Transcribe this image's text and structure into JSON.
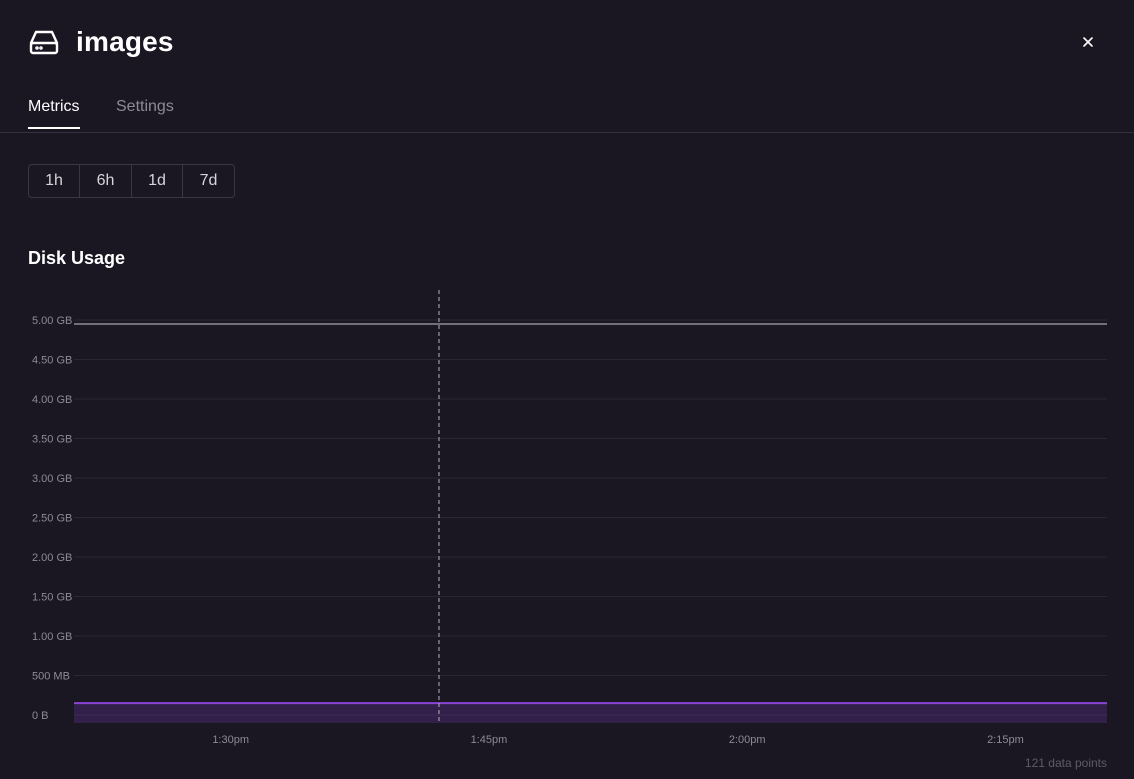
{
  "header": {
    "title": "images",
    "icon": "hard-drive-icon",
    "close_icon": "close-icon"
  },
  "tabs": [
    {
      "label": "Metrics",
      "active": true
    },
    {
      "label": "Settings",
      "active": false
    }
  ],
  "time_range": {
    "options": [
      "1h",
      "6h",
      "1d",
      "7d"
    ],
    "selected": "1h"
  },
  "section": {
    "title": "Disk Usage"
  },
  "chart_data": {
    "type": "area",
    "title": "Disk Usage",
    "y_tick_labels": [
      "0 B",
      "500 MB",
      "1.00 GB",
      "1.50 GB",
      "2.00 GB",
      "2.50 GB",
      "3.00 GB",
      "3.50 GB",
      "4.00 GB",
      "4.50 GB",
      "5.00 GB"
    ],
    "y_ticks_gb": [
      0,
      0.5,
      1.0,
      1.5,
      2.0,
      2.5,
      3.0,
      3.5,
      4.0,
      4.5,
      5.0
    ],
    "ylim_gb": [
      0,
      5.5
    ],
    "x_tick_labels": [
      "1:30pm",
      "1:45pm",
      "2:00pm",
      "2:15pm"
    ],
    "x_ticks_min": [
      9.1,
      24.1,
      39.1,
      54.1
    ],
    "xlim_min": [
      0,
      60
    ],
    "series": [
      {
        "values_gb": [
          0.15,
          0.15,
          0.15,
          0.15,
          0.15,
          0.15,
          0.15,
          0.15,
          0.15,
          0.15,
          0.15,
          0.15,
          0.15
        ],
        "color": "#8b45d6"
      }
    ],
    "limit_line_gb": 4.95,
    "hover_x_min": 21.2,
    "grid": true,
    "points_label": "121 data points"
  },
  "colors": {
    "background": "#1a1723",
    "accent": "#8b45d6",
    "grid": "#2a2633",
    "axis_text": "#8d8a96"
  }
}
